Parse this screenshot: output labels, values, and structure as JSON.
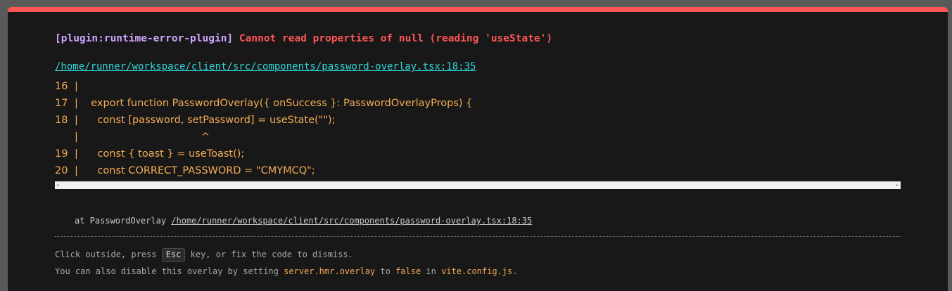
{
  "error": {
    "plugin": "[plugin:runtime-error-plugin]",
    "message": "Cannot read properties of null (reading 'useState')",
    "file": "/home/runner/workspace/client/src/components/password-overlay.tsx:18:35"
  },
  "frame": [
    {
      "line": "16",
      "bar": "|",
      "code": ""
    },
    {
      "line": "17",
      "bar": "|",
      "code": "  export function PasswordOverlay({ onSuccess }: PasswordOverlayProps) {"
    },
    {
      "line": "18",
      "bar": "|",
      "code": "    const [password, setPassword] = useState(\"\");"
    },
    {
      "line": "",
      "bar": "|",
      "code": "                                    ^"
    },
    {
      "line": "19",
      "bar": "|",
      "code": "    const { toast } = useToast();"
    },
    {
      "line": "20",
      "bar": "|",
      "code": "    const CORRECT_PASSWORD = \"CMYMCQ\";"
    }
  ],
  "stack": {
    "prefix": "at PasswordOverlay ",
    "link": "/home/runner/workspace/client/src/components/password-overlay.tsx:18:35"
  },
  "tips": {
    "line1_before": "Click outside, press ",
    "key": "Esc",
    "line1_after": " key, or fix the code to dismiss.",
    "line2_a": "You can also disable this overlay by setting ",
    "line2_setting": "server.hmr.overlay",
    "line2_b": " to ",
    "line2_value": "false",
    "line2_c": " in ",
    "line2_file": "vite.config.js",
    "line2_d": "."
  },
  "colors": {
    "accent": "#ff5555",
    "plugin": "#cfa4ff",
    "link": "#2dd9da",
    "code": "#f3ac55"
  }
}
